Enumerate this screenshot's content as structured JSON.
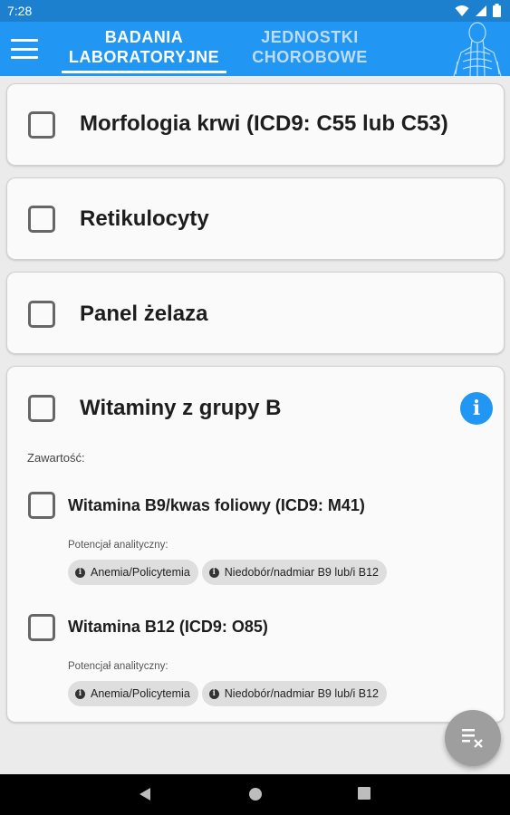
{
  "status_bar": {
    "time": "7:28"
  },
  "tabs": [
    {
      "line1": "BADANIA",
      "line2": "LABORATORYJNE",
      "active": true
    },
    {
      "line1": "JEDNOSTKI",
      "line2": "CHOROBOWE",
      "active": false
    }
  ],
  "cards": [
    {
      "title": "Morfologia krwi (ICD9: C55 lub C53)",
      "checked": false
    },
    {
      "title": "Retikulocyty",
      "checked": false
    },
    {
      "title": "Panel żelaza",
      "checked": false
    },
    {
      "title": "Witaminy z grupy B",
      "checked": false,
      "contents_label": "Zawartość:",
      "items": [
        {
          "title": "Witamina B9/kwas foliowy (ICD9: M41)",
          "analytic_label": "Potencjał analityczny:",
          "chips": [
            "Anemia/Policytemia",
            "Niedobór/nadmiar B9 lub/i B12"
          ]
        },
        {
          "title": "Witamina B12 (ICD9: O85)",
          "analytic_label": "Potencjał analityczny:",
          "chips": [
            "Anemia/Policytemia",
            "Niedobór/nadmiar B9 lub/i B12"
          ]
        }
      ]
    }
  ],
  "icons": {
    "menu": "hamburger-menu-icon",
    "info": "info-icon",
    "chip": "info-icon",
    "fab": "clear-list-icon",
    "nav": [
      "back-icon",
      "home-icon",
      "recents-icon"
    ]
  },
  "colors": {
    "primary": "#2196f3",
    "status_bar": "#1c80cf",
    "fab": "#9e9e9e",
    "background": "#ebebeb"
  }
}
